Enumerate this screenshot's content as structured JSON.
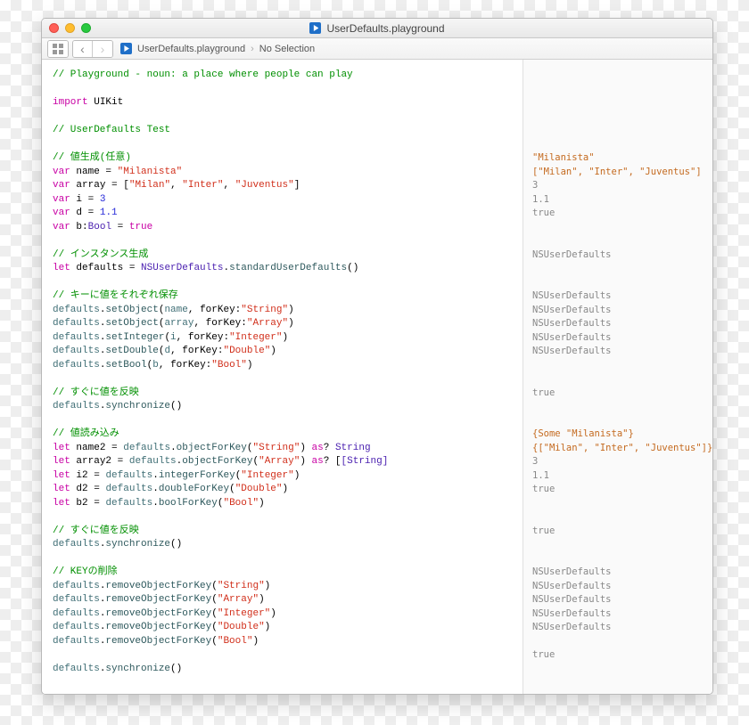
{
  "window": {
    "title": "UserDefaults.playground"
  },
  "toolbar": {
    "view_toggle": "grid-list",
    "breadcrumb_file": "UserDefaults.playground",
    "breadcrumb_selection": "No Selection"
  },
  "code": {
    "line01": "// Playground - noun: a place where people can play",
    "line03a": "import",
    "line03b": "UIKit",
    "line05": "// UserDefaults Test",
    "line07": "// 値生成(任意)",
    "line08_kw": "var",
    "line08_name": "name",
    "line08_eq": " = ",
    "line08_val": "\"Milanista\"",
    "line09_kw": "var",
    "line09_name": "array",
    "line09_eq": " = [",
    "line09_v1": "\"Milan\"",
    "line09_v2": "\"Inter\"",
    "line09_v3": "\"Juventus\"",
    "line09_close": "]",
    "line10_kw": "var",
    "line10_name": "i",
    "line10_eq": " = ",
    "line10_val": "3",
    "line11_kw": "var",
    "line11_name": "d",
    "line11_eq": " = ",
    "line11_val": "1.1",
    "line12_kw": "var",
    "line12_name": "b",
    "line12_type": "Bool",
    "line12_eq": " = ",
    "line12_val": "true",
    "line14": "// インスタンス生成",
    "line15_kw": "let",
    "line15_name": "defaults",
    "line15_eq": " = ",
    "line15_cls": "NSUserDefaults",
    "line15_dot": ".",
    "line15_m": "standardUserDefaults",
    "line15_pa": "()",
    "line17": "// キーに値をそれぞれ保存",
    "line18_r": "defaults",
    "line18_m": "setObject",
    "line18_a": "name",
    "line18_fk": "forKey",
    "line18_k": "\"String\"",
    "line19_r": "defaults",
    "line19_m": "setObject",
    "line19_a": "array",
    "line19_fk": "forKey",
    "line19_k": "\"Array\"",
    "line20_r": "defaults",
    "line20_m": "setInteger",
    "line20_a": "i",
    "line20_fk": "forKey",
    "line20_k": "\"Integer\"",
    "line21_r": "defaults",
    "line21_m": "setDouble",
    "line21_a": "d",
    "line21_fk": "forKey",
    "line21_k": "\"Double\"",
    "line22_r": "defaults",
    "line22_m": "setBool",
    "line22_a": "b",
    "line22_fk": "forKey",
    "line22_k": "\"Bool\"",
    "line24": "// すぐに値を反映",
    "line25_r": "defaults",
    "line25_m": "synchronize",
    "line25_pa": "()",
    "line27": "// 値読み込み",
    "line28_kw": "let",
    "line28_n": "name2",
    "line28_r": "defaults",
    "line28_m": "objectForKey",
    "line28_k": "\"String\"",
    "line28_as": "as",
    "line28_q": "?",
    "line28_t": "String",
    "line29_kw": "let",
    "line29_n": "array2",
    "line29_r": "defaults",
    "line29_m": "objectForKey",
    "line29_k": "\"Array\"",
    "line29_as": "as",
    "line29_q": "?",
    "line29_t": "[String]",
    "line30_kw": "let",
    "line30_n": "i2",
    "line30_r": "defaults",
    "line30_m": "integerForKey",
    "line30_k": "\"Integer\"",
    "line31_kw": "let",
    "line31_n": "d2",
    "line31_r": "defaults",
    "line31_m": "doubleForKey",
    "line31_k": "\"Double\"",
    "line32_kw": "let",
    "line32_n": "b2",
    "line32_r": "defaults",
    "line32_m": "boolForKey",
    "line32_k": "\"Bool\"",
    "line34": "// すぐに値を反映",
    "line35_r": "defaults",
    "line35_m": "synchronize",
    "line35_pa": "()",
    "line37": "// KEYの削除",
    "line38_r": "defaults",
    "line38_m": "removeObjectForKey",
    "line38_k": "\"String\"",
    "line39_r": "defaults",
    "line39_m": "removeObjectForKey",
    "line39_k": "\"Array\"",
    "line40_r": "defaults",
    "line40_m": "removeObjectForKey",
    "line40_k": "\"Integer\"",
    "line41_r": "defaults",
    "line41_m": "removeObjectForKey",
    "line41_k": "\"Double\"",
    "line42_r": "defaults",
    "line42_m": "removeObjectForKey",
    "line42_k": "\"Bool\"",
    "line44_r": "defaults",
    "line44_m": "synchronize",
    "line44_pa": "()"
  },
  "results": {
    "r08": "\"Milanista\"",
    "r09": "[\"Milan\", \"Inter\", \"Juventus\"]",
    "r10": "3",
    "r11": "1.1",
    "r12": "true",
    "r15": "NSUserDefaults",
    "r18": "NSUserDefaults",
    "r19": "NSUserDefaults",
    "r20": "NSUserDefaults",
    "r21": "NSUserDefaults",
    "r22": "NSUserDefaults",
    "r25": "true",
    "r28": "{Some \"Milanista\"}",
    "r29": "{[\"Milan\", \"Inter\", \"Juventus\"]}",
    "r30": "3",
    "r31": "1.1",
    "r32": "true",
    "r35": "true",
    "r38": "NSUserDefaults",
    "r39": "NSUserDefaults",
    "r40": "NSUserDefaults",
    "r41": "NSUserDefaults",
    "r42": "NSUserDefaults",
    "r44": "true"
  }
}
